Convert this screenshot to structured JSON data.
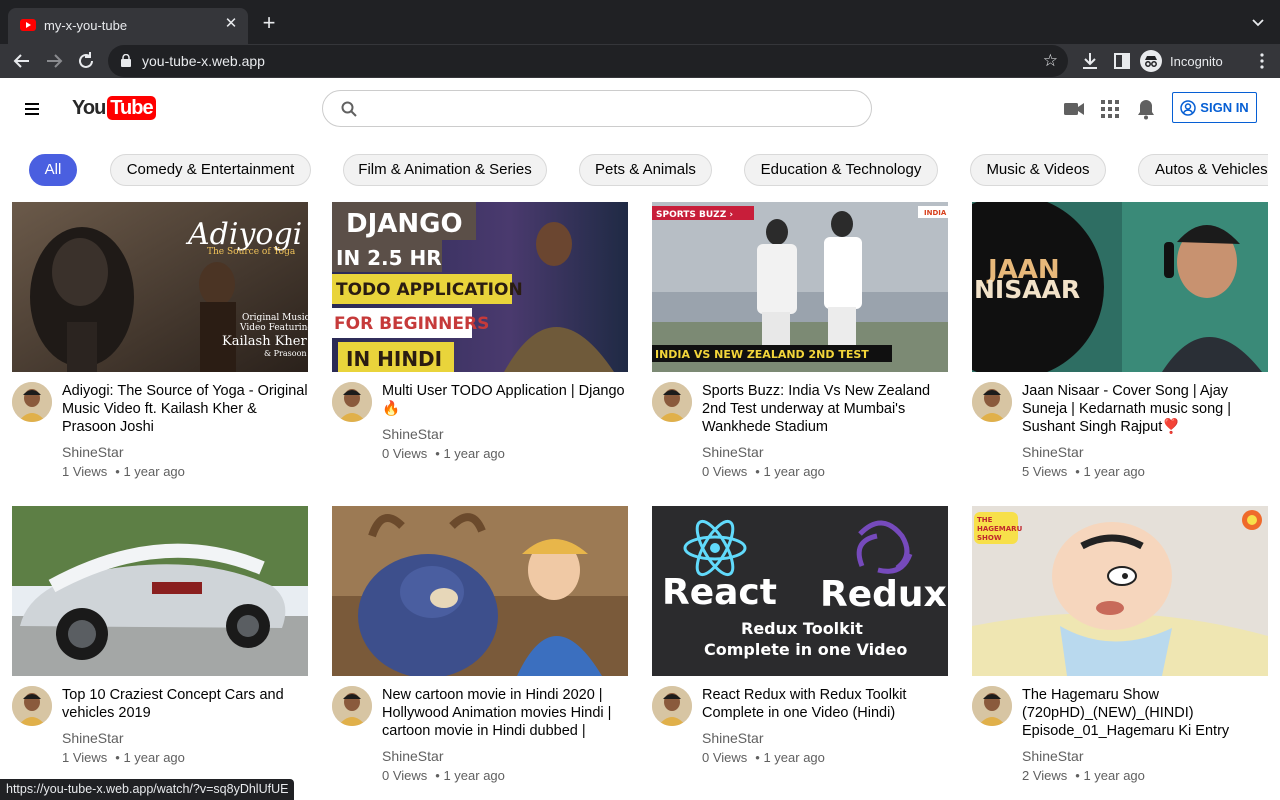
{
  "browser": {
    "tab_title": "my-x-you-tube",
    "tab_close": "✕",
    "new_tab": "+",
    "url": "you-tube-x.web.app",
    "profile_label": "Incognito",
    "status_url": "https://you-tube-x.web.app/watch/?v=sq8yDhlUfUE"
  },
  "header": {
    "logo_you": "You",
    "logo_tube": "Tube",
    "search_placeholder": "",
    "signin_label": "SIGN IN"
  },
  "chips": [
    {
      "label": "All",
      "active": true
    },
    {
      "label": "Comedy & Entertainment"
    },
    {
      "label": "Film & Animation & Series"
    },
    {
      "label": "Pets & Animals"
    },
    {
      "label": "Education & Technology"
    },
    {
      "label": "Music & Videos"
    },
    {
      "label": "Autos & Vehicles"
    }
  ],
  "videos": [
    {
      "title": "Adiyogi: The Source of Yoga - Original Music Video ft. Kailash Kher & Prasoon Joshi",
      "channel": "ShineStar",
      "views": "1 Views",
      "age": "• 1 year ago",
      "thumb": {
        "big": "Adiyogi",
        "sub": "The Source of Yoga",
        "line1": "Original Music",
        "line2": "Video Featuring",
        "name": "Kailash Kher",
        "name2": "& Prasoon Joshi"
      }
    },
    {
      "title": "Multi User TODO Application | Django 🔥",
      "channel": "ShineStar",
      "views": "0 Views",
      "age": "• 1 year ago",
      "thumb": {
        "l1": "DJANGO",
        "l2": "IN 2.5 HR",
        "l3": "TODO APPLICATION",
        "l4": "FOR BEGINNERS",
        "l5": "IN HINDI"
      }
    },
    {
      "title": "Sports Buzz: India Vs New Zealand 2nd Test underway at Mumbai's Wankhede Stadium",
      "channel": "ShineStar",
      "views": "0 Views",
      "age": "• 1 year ago",
      "thumb": {
        "tag": "SPORTS BUZZ ›",
        "corner": "INDIA",
        "caption": "INDIA VS NEW ZEALAND 2ND TEST"
      }
    },
    {
      "title": "Jaan Nisaar - Cover Song | Ajay Suneja | Kedarnath music song | Sushant Singh Rajput❣️",
      "channel": "ShineStar",
      "views": "5 Views",
      "age": "• 1 year ago",
      "thumb": {
        "t1": "JAAN",
        "t2": "NISAAR"
      }
    },
    {
      "title": "Top 10 Craziest Concept Cars and vehicles 2019",
      "channel": "ShineStar",
      "views": "1 Views",
      "age": "• 1 year ago",
      "thumb": {}
    },
    {
      "title": "New cartoon movie in Hindi 2020 | Hollywood Animation movies Hindi | cartoon movie in Hindi dubbed |",
      "channel": "ShineStar",
      "views": "0 Views",
      "age": "• 1 year ago",
      "thumb": {}
    },
    {
      "title": "React Redux with Redux Toolkit Complete in one Video (Hindi)",
      "channel": "ShineStar",
      "views": "0 Views",
      "age": "• 1 year ago",
      "thumb": {
        "left": "React",
        "right": "Redux",
        "c1": "Redux Toolkit",
        "c2": "Complete in one Video"
      }
    },
    {
      "title": "The Hagemaru Show (720pHD)_(NEW)_(HINDI) Episode_01_Hagemaru Ki Entry",
      "channel": "ShineStar",
      "views": "2 Views",
      "age": "• 1 year ago",
      "thumb": {
        "badge1": "THE",
        "badge2": "HAGEMARU",
        "badge3": "SHOW"
      }
    }
  ],
  "colors": {
    "accent": "#4a5fe0",
    "signin": "#065fd4",
    "brand_red": "#ff0000"
  }
}
